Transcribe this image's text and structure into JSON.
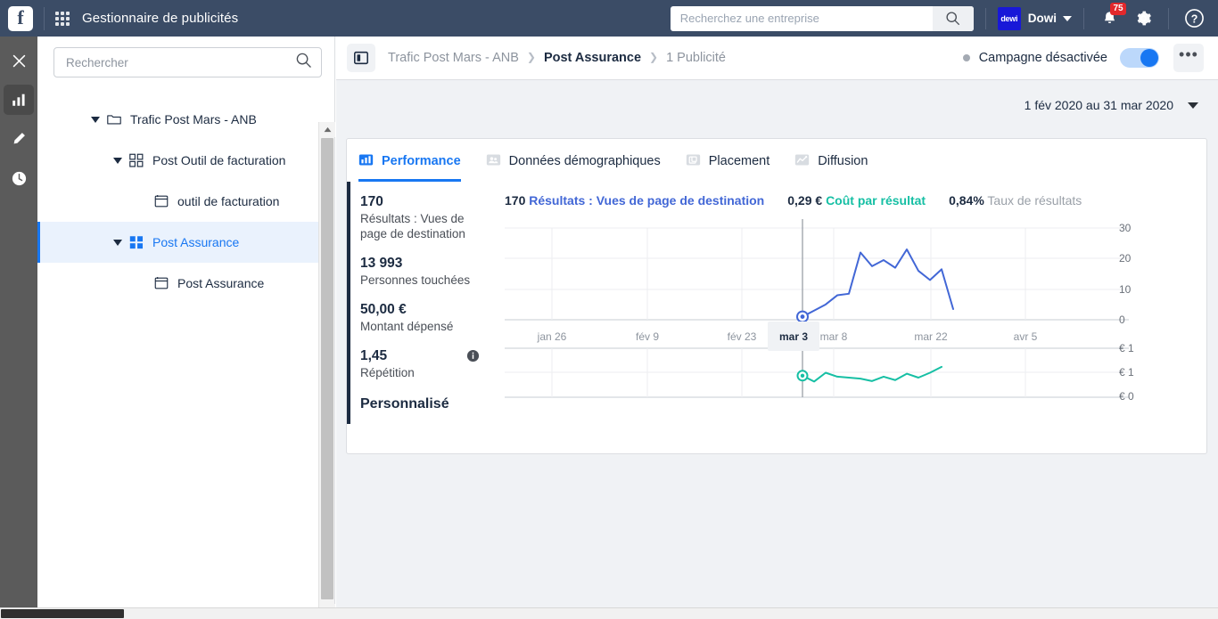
{
  "topbar": {
    "logo_letter": "f",
    "apps_icon": "apps-grid-icon",
    "app_title": "Gestionnaire de publicités",
    "search": {
      "placeholder": "Recherchez une entreprise",
      "value": "",
      "icon": "search-icon"
    },
    "business_logo_text": "dewi",
    "account_name": "Dowi",
    "notifications": {
      "icon": "bell-icon",
      "count": "75"
    },
    "settings_icon": "gear-icon",
    "help_icon": "question-mark-icon"
  },
  "rail": {
    "items": [
      {
        "icon": "close-icon",
        "name": "close",
        "active": false
      },
      {
        "icon": "bar-chart-icon",
        "name": "charts",
        "active": true
      },
      {
        "icon": "pencil-icon",
        "name": "edit",
        "active": false
      },
      {
        "icon": "clock-icon",
        "name": "history",
        "active": false
      }
    ]
  },
  "sidebar": {
    "search": {
      "placeholder": "Rechercher",
      "value": "",
      "icon": "search-icon"
    },
    "tree": [
      {
        "label": "Trafic Post Mars - ANB",
        "icon": "folder-icon",
        "depth": 0,
        "expanded": true,
        "selected": false
      },
      {
        "label": "Post Outil de facturation",
        "icon": "adset-grid-icon",
        "depth": 1,
        "expanded": true,
        "selected": false
      },
      {
        "label": "outil de facturation",
        "icon": "ad-card-icon",
        "depth": 2,
        "expanded": null,
        "selected": false
      },
      {
        "label": "Post Assurance",
        "icon": "adset-grid-icon",
        "depth": 1,
        "expanded": true,
        "selected": true
      },
      {
        "label": "Post Assurance",
        "icon": "ad-card-icon",
        "depth": 2,
        "expanded": null,
        "selected": false
      }
    ],
    "scrollbar": {
      "up_icon": "triangle-up-icon",
      "down_icon": "triangle-down-icon"
    }
  },
  "main": {
    "panel_toggle_icon": "side-panel-icon",
    "breadcrumb": [
      {
        "label": "Trafic Post Mars - ANB",
        "current": false
      },
      {
        "label": "Post Assurance",
        "current": true
      },
      {
        "label": "1 Publicité",
        "current": false
      }
    ],
    "breadcrumb_separator": "❯",
    "campaign_status": "Campagne désactivée",
    "toggle_on": true,
    "more_label": "•••",
    "date_range": "1 fév 2020 au 31 mar 2020",
    "tabs": [
      {
        "label": "Performance",
        "icon": "bar-chart-icon",
        "active": true
      },
      {
        "label": "Données démographiques",
        "icon": "people-icon",
        "active": false
      },
      {
        "label": "Placement",
        "icon": "placement-icon",
        "active": false
      },
      {
        "label": "Diffusion",
        "icon": "delivery-line-icon",
        "active": false
      }
    ],
    "metrics": [
      {
        "value": "170",
        "label": "Résultats : Vues de page de destination",
        "info": false
      },
      {
        "value": "13 993",
        "label": "Personnes touchées",
        "info": false
      },
      {
        "value": "50,00 €",
        "label": "Montant dépensé",
        "info": false
      },
      {
        "value": "1,45",
        "label": "Répétition",
        "info": true
      }
    ],
    "custom_section_title": "Personnalisé",
    "info_icon": "info-circle-icon"
  },
  "chart_data": {
    "type": "line",
    "title": "",
    "grid": true,
    "legend_position": "top",
    "legend": [
      {
        "num": "170",
        "label": "Résultats : Vues de page de destination",
        "color": "#4267d6"
      },
      {
        "num": "0,29 €",
        "label": "Coût par résultat",
        "color": "#16bfa4"
      },
      {
        "num": "0,84%",
        "label": "Taux de résultats",
        "color": "#9aa0a8"
      }
    ],
    "xlabel": "",
    "x_ticks": [
      "jan 26",
      "fév 9",
      "fév 23",
      "mar 3",
      "mar 8",
      "mar 22",
      "avr 5"
    ],
    "x_highlight": "mar 3",
    "panels": [
      {
        "name": "results",
        "ylabel": "",
        "y_ticks": [
          "30",
          "20",
          "10",
          "0"
        ],
        "ylim": [
          0,
          30
        ],
        "series": [
          {
            "name": "Résultats : Vues de page de destination",
            "color": "#4267d6",
            "marker_index": 0,
            "values": [
              1,
              3,
              5,
              8,
              8.5,
              22,
              17.5,
              19.5,
              17,
              23,
              16,
              13,
              16.5,
              3.5
            ]
          }
        ]
      },
      {
        "name": "cost_per_result",
        "ylabel": "",
        "y_ticks": [
          "€ 1",
          "€ 1",
          "€ 0"
        ],
        "ylim": [
          0,
          1
        ],
        "series": [
          {
            "name": "Coût par résultat",
            "color": "#16bfa4",
            "marker_index": 0,
            "values": [
              0.44,
              0.32,
              0.5,
              0.42,
              0.4,
              0.38,
              0.33,
              0.42,
              0.35,
              0.48,
              0.4,
              0.5,
              0.62
            ]
          }
        ]
      }
    ]
  }
}
